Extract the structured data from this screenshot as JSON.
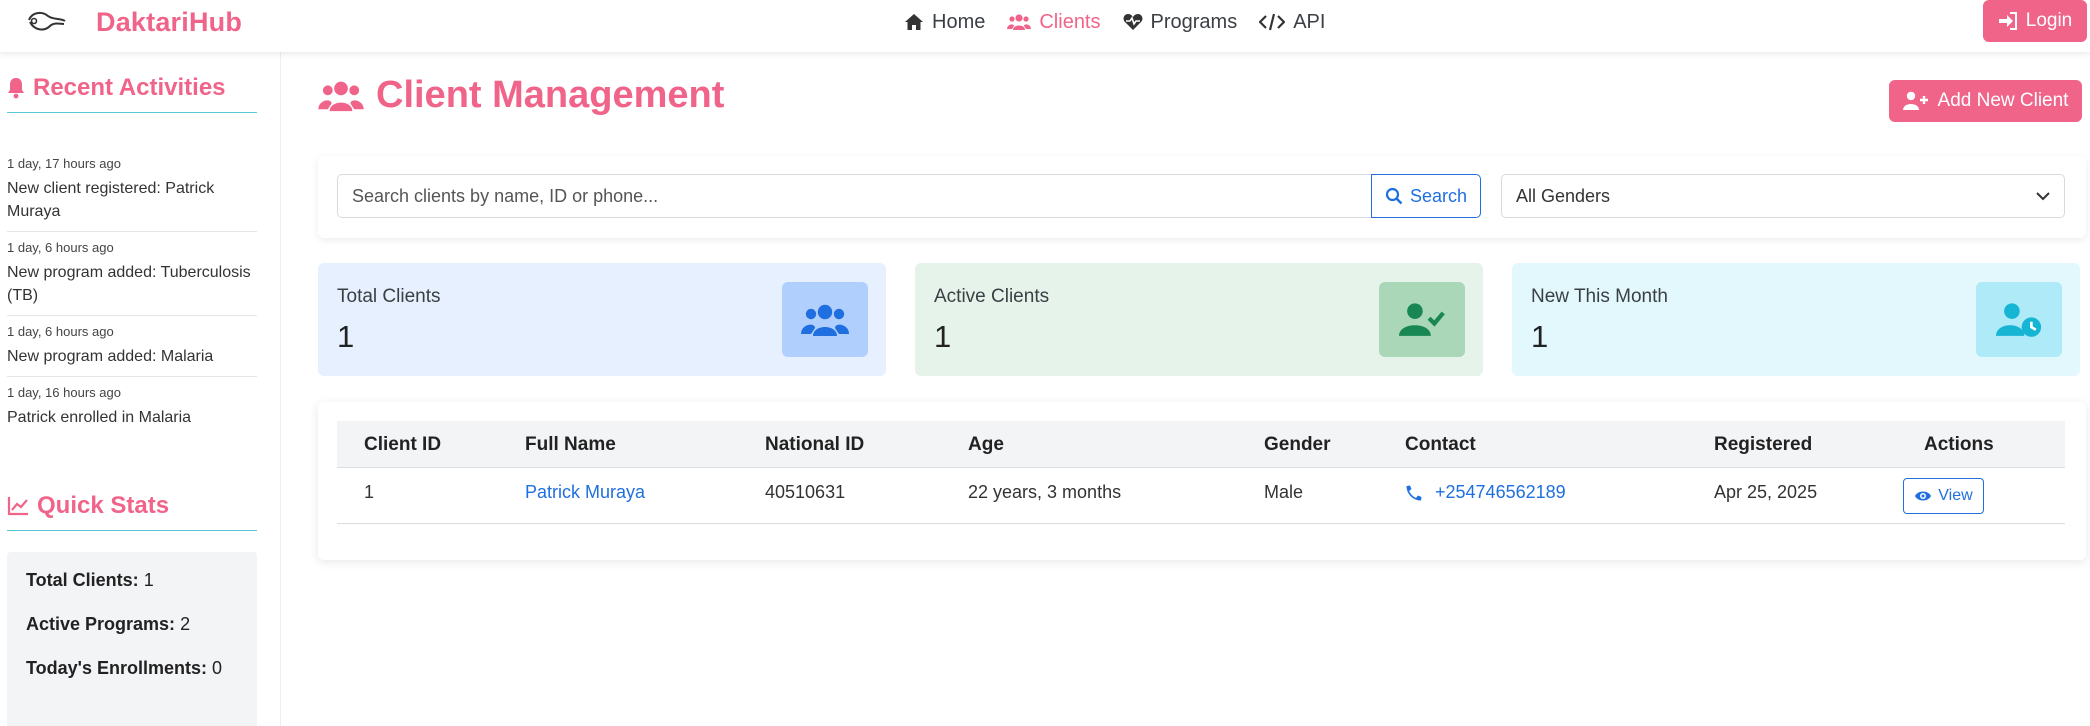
{
  "navbar": {
    "brand": "DaktariHub",
    "links": [
      {
        "label": "Home",
        "icon": "home-icon"
      },
      {
        "label": "Clients",
        "icon": "users-icon",
        "active": true
      },
      {
        "label": "Programs",
        "icon": "heart-pulse-icon"
      },
      {
        "label": "API",
        "icon": "code-icon"
      }
    ],
    "login_label": "Login"
  },
  "sidebar": {
    "recent_title": "Recent Activities",
    "activities": [
      {
        "time": "1 day, 17 hours ago",
        "text": "New client registered: Patrick Muraya"
      },
      {
        "time": "1 day, 6 hours ago",
        "text": "New program added: Tuberculosis (TB)"
      },
      {
        "time": "1 day, 6 hours ago",
        "text": "New program added: Malaria"
      },
      {
        "time": "1 day, 16 hours ago",
        "text": "Patrick enrolled in Malaria"
      }
    ],
    "stats_title": "Quick Stats",
    "stats": [
      {
        "label": "Total Clients:",
        "value": "1"
      },
      {
        "label": "Active Programs:",
        "value": "2"
      },
      {
        "label": "Today's Enrollments:",
        "value": "0"
      }
    ]
  },
  "main": {
    "title": "Client Management",
    "add_button": "Add New Client",
    "search": {
      "placeholder": "Search clients by name, ID or phone...",
      "button": "Search"
    },
    "gender_filter": {
      "selected": "All Genders"
    },
    "cards": [
      {
        "label": "Total Clients",
        "value": "1",
        "bg": "#e7f0fe",
        "icon_bg": "#b1cffc",
        "icon_color": "#1f6fe0",
        "icon": "users-icon"
      },
      {
        "label": "Active Clients",
        "value": "1",
        "bg": "#e6f3ea",
        "icon_bg": "#a9d7b7",
        "icon_color": "#198754",
        "icon": "user-check-icon"
      },
      {
        "label": "New This Month",
        "value": "1",
        "bg": "#e3f8fc",
        "icon_bg": "#aeeaf7",
        "icon_color": "#17b5d4",
        "icon": "user-clock-icon"
      }
    ],
    "table": {
      "columns": [
        "Client ID",
        "Full Name",
        "National ID",
        "Age",
        "Gender",
        "Contact",
        "Registered",
        "Actions"
      ],
      "rows": [
        {
          "id": "1",
          "name": "Patrick Muraya",
          "national_id": "40510631",
          "age": "22 years, 3 months",
          "gender": "Male",
          "contact": "+254746562189",
          "registered": "Apr 25, 2025",
          "action": "View"
        }
      ]
    }
  },
  "colors": {
    "brand": "#f0648a",
    "link": "#1f6fe0",
    "divider": "#5bc8d9"
  }
}
